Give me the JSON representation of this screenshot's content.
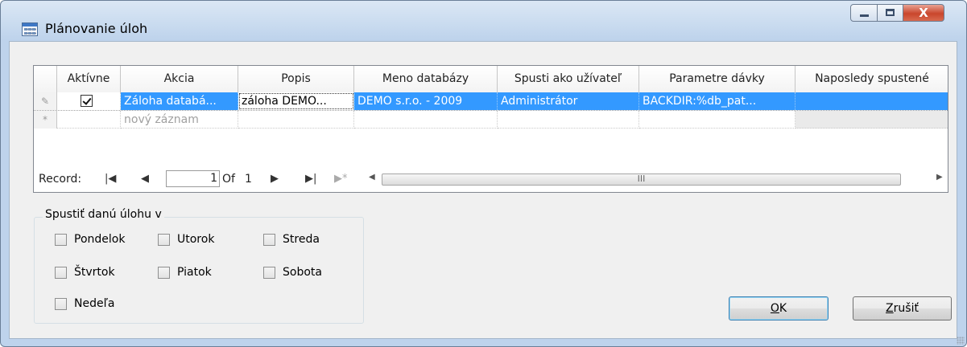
{
  "window": {
    "title": "Plánovanie úloh",
    "close_glyph": "X"
  },
  "grid": {
    "columns": [
      "Aktívne",
      "Akcia",
      "Popis",
      "Meno databázy",
      "Spusti ako užívateľ",
      "Parametre dávky",
      "Naposledy spustené"
    ],
    "rows": [
      {
        "selector_icon": "✎",
        "active": true,
        "akcia": "Záloha databá...",
        "popis": "záloha DEMO...",
        "meno_databazy": "DEMO s.r.o. - 2009",
        "spusti_ako": "Administrátor",
        "parametre": "BACKDIR:%db_pat...",
        "naposledy": ""
      }
    ],
    "new_row": {
      "selector_icon": "*",
      "akcia": "nový záznam"
    }
  },
  "navigator": {
    "label": "Record:",
    "current": "1",
    "of_label": "Of",
    "total": "1",
    "first_icon": "|◀",
    "prev_icon": "◀",
    "next_icon": "▶",
    "last_icon": "▶|",
    "new_icon": "▶*",
    "scroll_left": "◀",
    "scroll_right": "▶",
    "scroll_thumb": "III"
  },
  "schedule": {
    "group_title": "Spustiť danú úlohu v",
    "days": [
      {
        "label": "Pondelok",
        "checked": false
      },
      {
        "label": "Utorok",
        "checked": false
      },
      {
        "label": "Streda",
        "checked": false
      },
      {
        "label": "Štvrtok",
        "checked": false
      },
      {
        "label": "Piatok",
        "checked": false
      },
      {
        "label": "Sobota",
        "checked": false
      },
      {
        "label": "Nedeľa",
        "checked": false
      }
    ]
  },
  "buttons": {
    "ok_mnemonic": "O",
    "ok_rest": "K",
    "cancel_mnemonic": "Z",
    "cancel_rest": "rušiť"
  }
}
